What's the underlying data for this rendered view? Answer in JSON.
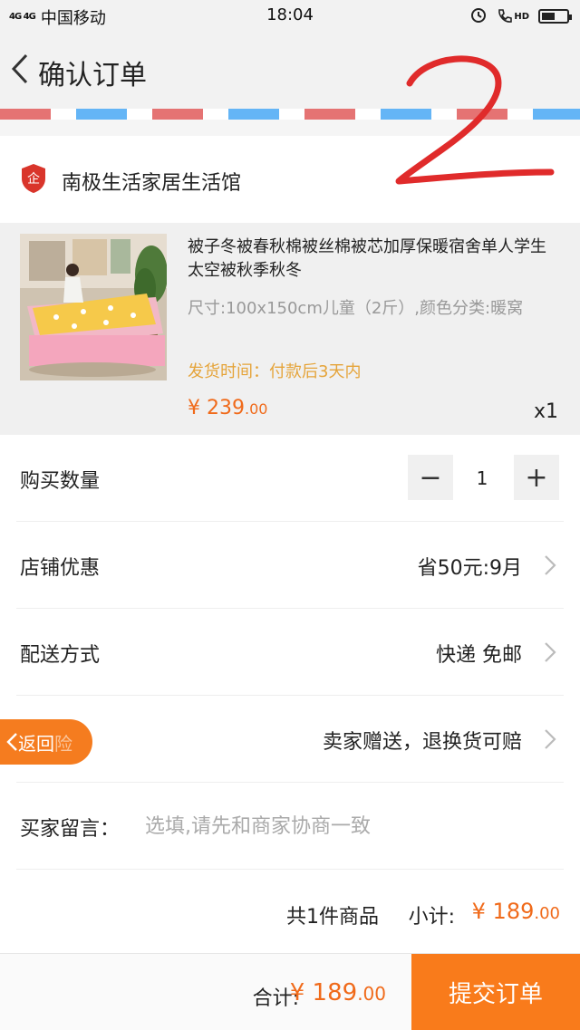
{
  "status_bar": {
    "network": "4G 4G",
    "carrier": "中国移动",
    "time": "18:04",
    "hd_label": "HD"
  },
  "header": {
    "title": "确认订单"
  },
  "shop": {
    "name": "南极生活家居生活馆",
    "badge_text": "企"
  },
  "product": {
    "title": "被子冬被春秋棉被丝棉被芯加厚保暖宿舍单人学生太空被秋季秋冬",
    "spec": "尺寸:100x150cm儿童（2斤）,颜色分类:暖窝",
    "ship_time": "发货时间：付款后3天内",
    "price_symbol": "¥",
    "price_int": "239",
    "price_dec": ".00",
    "quantity": "x1"
  },
  "form": {
    "qty_label": "购买数量",
    "qty_minus": "−",
    "qty_value": "1",
    "qty_plus": "+",
    "discount_label": "店铺优惠",
    "discount_value": "省50元:9月",
    "delivery_label": "配送方式",
    "delivery_value": "快递 免邮",
    "return_btn_main": "返回",
    "return_btn_faded": "险",
    "insurance_value": "卖家赠送，退换货可赔",
    "note_label": "买家留言：",
    "note_placeholder": "选填,请先和商家协商一致"
  },
  "summary": {
    "count": "共1件商品",
    "subtotal_label": "小计:",
    "subtotal_symbol": "¥",
    "subtotal_int": "189",
    "subtotal_dec": ".00"
  },
  "bottom": {
    "total_label": "合计:",
    "total_symbol": "¥",
    "total_int": "189",
    "total_dec": ".00",
    "submit_label": "提交订单"
  },
  "annotation": {
    "handwritten_mark": "2"
  },
  "colors": {
    "accent": "#f97b1b",
    "price": "#f06a1a",
    "ship_time": "#e5a43a",
    "shop_badge": "#d9352b"
  }
}
